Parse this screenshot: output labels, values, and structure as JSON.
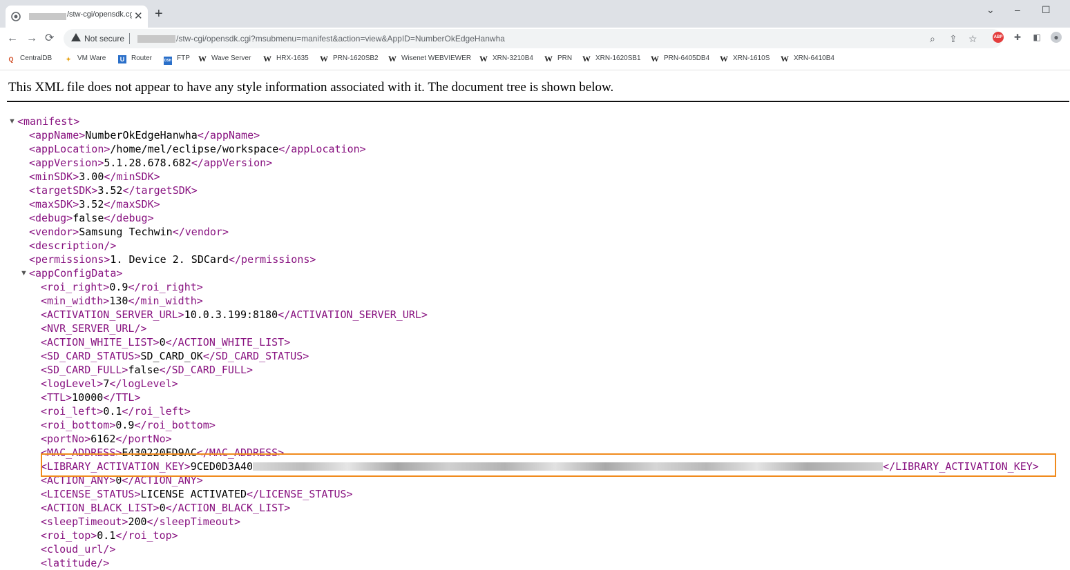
{
  "browser": {
    "tab": {
      "title": "/stw-cgi/opensdk.cgi",
      "close_icon": "close-icon",
      "favicon": "globe-icon"
    },
    "new_tab_label": "+",
    "window_controls": {
      "minimize": "–",
      "maximize": "☐",
      "menu": "⌄"
    },
    "nav": {
      "back": "←",
      "forward": "→",
      "reload": "⟳"
    },
    "address": {
      "security_label": "Not secure",
      "url": "/stw-cgi/opensdk.cgi?msubmenu=manifest&action=view&AppID=NumberOkEdgeHanwha"
    },
    "bookmarks": [
      {
        "label": "CentralDB",
        "icon": "Q"
      },
      {
        "label": "VM Ware",
        "icon": "✦"
      },
      {
        "label": "Router",
        "icon": "U"
      },
      {
        "label": "FTP",
        "icon": "DSH"
      },
      {
        "label": "Wave Server",
        "icon": "W"
      },
      {
        "label": "HRX-1635",
        "icon": "W"
      },
      {
        "label": "PRN-1620SB2",
        "icon": "W"
      },
      {
        "label": "Wisenet WEBVIEWER",
        "icon": "W"
      },
      {
        "label": "XRN-3210B4",
        "icon": "W"
      },
      {
        "label": "PRN",
        "icon": "W"
      },
      {
        "label": "XRN-1620SB1",
        "icon": "W"
      },
      {
        "label": "PRN-6405DB4",
        "icon": "W"
      },
      {
        "label": "XRN-1610S",
        "icon": "W"
      },
      {
        "label": "XRN-6410B4",
        "icon": "W"
      }
    ]
  },
  "xml_viewer": {
    "notice": "This XML file does not appear to have any style information associated with it. The document tree is shown below.",
    "root_open": "<manifest>",
    "config_open": "<appConfigData>",
    "manifest_lines": [
      {
        "open": "<appName>",
        "value": "NumberOkEdgeHanwha",
        "close": "</appName>"
      },
      {
        "open": "<appLocation>",
        "value": "/home/mel/eclipse/workspace",
        "close": "</appLocation>"
      },
      {
        "open": "<appVersion>",
        "value": "5.1.28.678.682",
        "close": "</appVersion>"
      },
      {
        "open": "<minSDK>",
        "value": "3.00",
        "close": "</minSDK>"
      },
      {
        "open": "<targetSDK>",
        "value": "3.52",
        "close": "</targetSDK>"
      },
      {
        "open": "<maxSDK>",
        "value": "3.52",
        "close": "</maxSDK>"
      },
      {
        "open": "<debug>",
        "value": "false",
        "close": "</debug>"
      },
      {
        "open": "<vendor>",
        "value": "Samsung Techwin",
        "close": "</vendor>"
      },
      {
        "open": "<description/>",
        "value": "",
        "close": ""
      },
      {
        "open": "<permissions>",
        "value": "1. Device 2. SDCard",
        "close": "</permissions>"
      }
    ],
    "config_lines": [
      {
        "open": "<roi_right>",
        "value": "0.9",
        "close": "</roi_right>"
      },
      {
        "open": "<min_width>",
        "value": "130",
        "close": "</min_width>"
      },
      {
        "open": "<ACTIVATION_SERVER_URL>",
        "value": "10.0.3.199:8180",
        "close": "</ACTIVATION_SERVER_URL>"
      },
      {
        "open": "<NVR_SERVER_URL/>",
        "value": "",
        "close": ""
      },
      {
        "open": "<ACTION_WHITE_LIST>",
        "value": "0",
        "close": "</ACTION_WHITE_LIST>"
      },
      {
        "open": "<SD_CARD_STATUS>",
        "value": "SD_CARD_OK",
        "close": "</SD_CARD_STATUS>"
      },
      {
        "open": "<SD_CARD_FULL>",
        "value": "false",
        "close": "</SD_CARD_FULL>"
      },
      {
        "open": "<logLevel>",
        "value": "7",
        "close": "</logLevel>"
      },
      {
        "open": "<TTL>",
        "value": "10000",
        "close": "</TTL>"
      },
      {
        "open": "<roi_left>",
        "value": "0.1",
        "close": "</roi_left>"
      },
      {
        "open": "<roi_bottom>",
        "value": "0.9",
        "close": "</roi_bottom>"
      },
      {
        "open": "<portNo>",
        "value": "6162",
        "close": "</portNo>"
      },
      {
        "open": "<MAC_ADDRESS>",
        "value": "E430220FD9AC",
        "close": "</MAC_ADDRESS>"
      },
      {
        "open": "<LIBRARY_ACTIVATION_KEY>",
        "value": "9CED0D3A40",
        "close": "</LIBRARY_ACTIVATION_KEY>",
        "redacted": true
      },
      {
        "open": "<ACTION_ANY>",
        "value": "0",
        "close": "</ACTION_ANY>"
      },
      {
        "open": "<LICENSE_STATUS>",
        "value": "LICENSE ACTIVATED",
        "close": "</LICENSE_STATUS>"
      },
      {
        "open": "<ACTION_BLACK_LIST>",
        "value": "0",
        "close": "</ACTION_BLACK_LIST>"
      },
      {
        "open": "<sleepTimeout>",
        "value": "200",
        "close": "</sleepTimeout>"
      },
      {
        "open": "<roi_top>",
        "value": "0.1",
        "close": "</roi_top>"
      },
      {
        "open": "<cloud_url/>",
        "value": "",
        "close": ""
      },
      {
        "open": "<latitude/>",
        "value": "",
        "close": ""
      }
    ]
  },
  "colors": {
    "tag": "#881280",
    "highlight_border": "#f08a1c",
    "tab_strip": "#dee1e6"
  }
}
